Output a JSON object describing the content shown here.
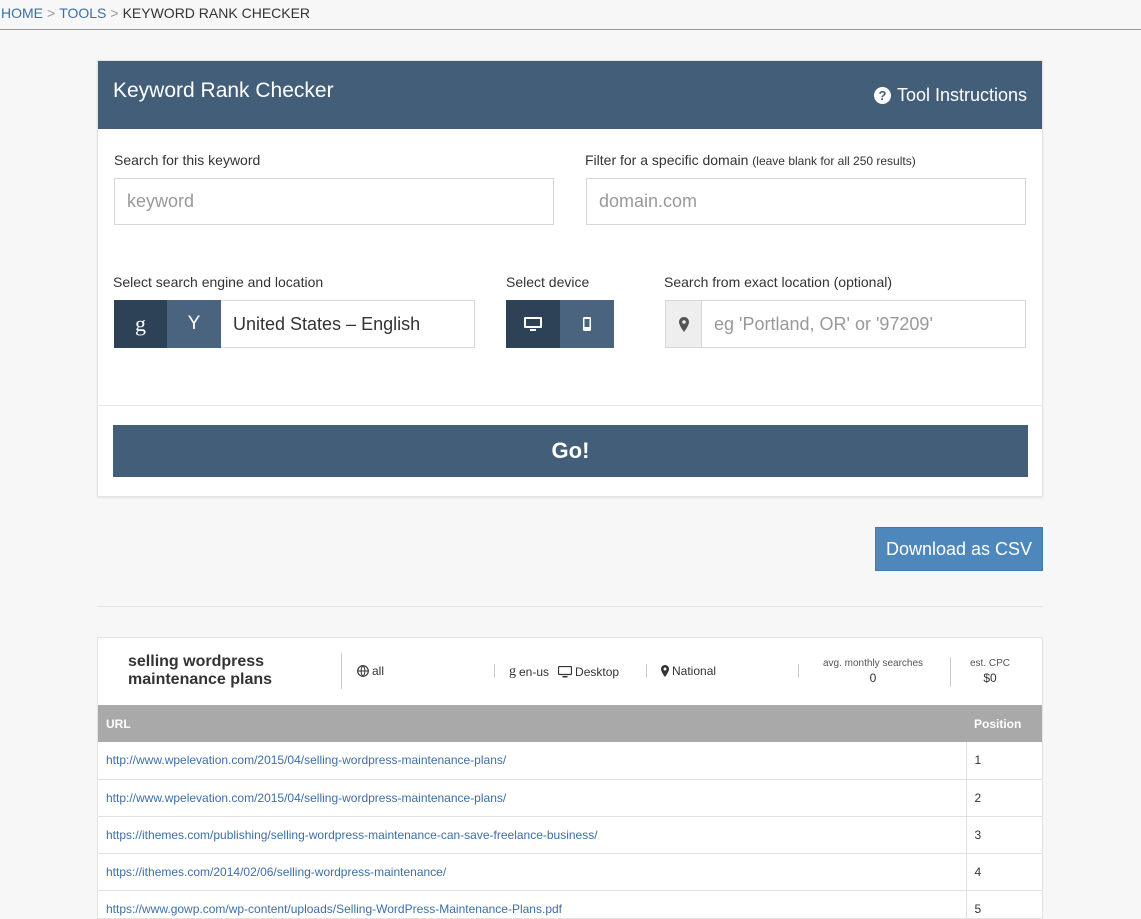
{
  "breadcrumb": {
    "home": "HOME",
    "tools": "TOOLS",
    "current": "KEYWORD RANK CHECKER",
    "separator": ">"
  },
  "panel": {
    "title": "Keyword Rank Checker",
    "instructions": "Tool Instructions"
  },
  "form": {
    "keyword_label": "Search for this keyword",
    "keyword_placeholder": "keyword",
    "domain_label": "Filter for a specific domain",
    "domain_label_note": "(leave blank for all 250 results)",
    "domain_placeholder": "domain.com",
    "engine_label": "Select search engine and location",
    "engine_google": "g",
    "engine_yahoo": "Y",
    "engine_location": "United States – English",
    "device_label": "Select device",
    "exact_label": "Search from exact location (optional)",
    "exact_placeholder": "eg 'Portland, OR' or '97209'",
    "go": "Go!"
  },
  "csv_button": "Download as CSV",
  "summary": {
    "keyword": "selling wordpress maintenance plans",
    "scope": "all",
    "engine_icon": "g",
    "locale": "en-us",
    "device": "Desktop",
    "location": "National",
    "avg_label": "avg. monthly searches",
    "avg_value": "0",
    "cpc_label": "est. CPC",
    "cpc_value": "$0"
  },
  "table": {
    "headers": {
      "url": "URL",
      "position": "Position"
    },
    "rows": [
      {
        "url": "http://www.wpelevation.com/2015/04/selling-wordpress-maintenance-plans/",
        "position": "1"
      },
      {
        "url": "http://www.wpelevation.com/2015/04/selling-wordpress-maintenance-plans/",
        "position": "2"
      },
      {
        "url": "https://ithemes.com/publishing/selling-wordpress-maintenance-can-save-freelance-business/",
        "position": "3"
      },
      {
        "url": "https://ithemes.com/2014/02/06/selling-wordpress-maintenance/",
        "position": "4"
      },
      {
        "url": "https://www.gowp.com/wp-content/uploads/Selling-WordPress-Maintenance-Plans.pdf",
        "position": "5"
      }
    ]
  },
  "colors": {
    "header": "#425e79",
    "accent": "#4e87bb",
    "link": "#3d6fa6",
    "table_head": "#a9a9a9"
  }
}
